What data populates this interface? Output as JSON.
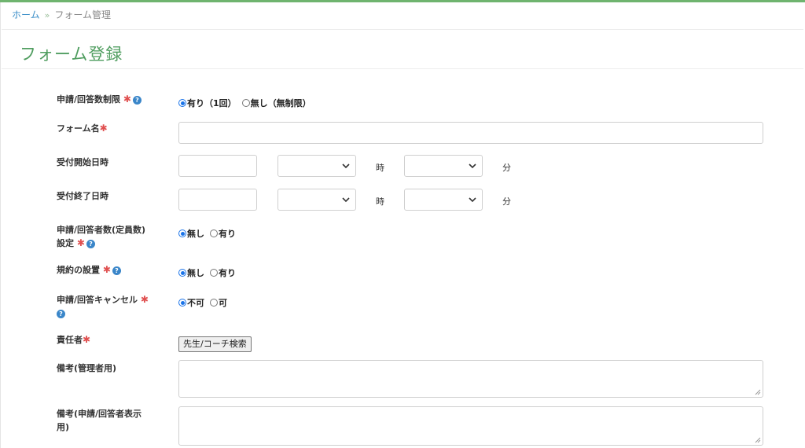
{
  "breadcrumb": {
    "home": "ホーム",
    "separator": "»",
    "current": "フォーム管理"
  },
  "page_title": "フォーム登録",
  "required_mark": "✱",
  "help_glyph": "?",
  "fields": {
    "limit": {
      "label": "申請/回答数制限",
      "options": [
        "有り（1回）",
        "無し（無制限）"
      ],
      "selected": 0
    },
    "form_name": {
      "label": "フォーム名",
      "value": "",
      "placeholder": ""
    },
    "start": {
      "label": "受付開始日時",
      "hour_unit": "時",
      "minute_unit": "分"
    },
    "end": {
      "label": "受付終了日時",
      "hour_unit": "時",
      "minute_unit": "分"
    },
    "capacity": {
      "label_line1": "申請/回答者数(定員数)",
      "label_line2": "設定",
      "options": [
        "無し",
        "有り"
      ],
      "selected": 0
    },
    "terms": {
      "label": "規約の設置",
      "options": [
        "無し",
        "有り"
      ],
      "selected": 0
    },
    "cancel": {
      "label": "申請/回答キャンセル",
      "options": [
        "不可",
        "可"
      ],
      "selected": 0
    },
    "owner": {
      "label": "責任者",
      "button": "先生/コーチ検索"
    },
    "note_admin": {
      "label": "備考(管理者用)",
      "value": ""
    },
    "note_public": {
      "label_line1": "備考(申請/回答者表示",
      "label_line2": "用)",
      "value": ""
    }
  },
  "colors": {
    "accent_green": "#4f9d5f",
    "link_blue": "#3a8ec8",
    "required_red": "#e05050",
    "radio_blue": "#1a73e8"
  }
}
